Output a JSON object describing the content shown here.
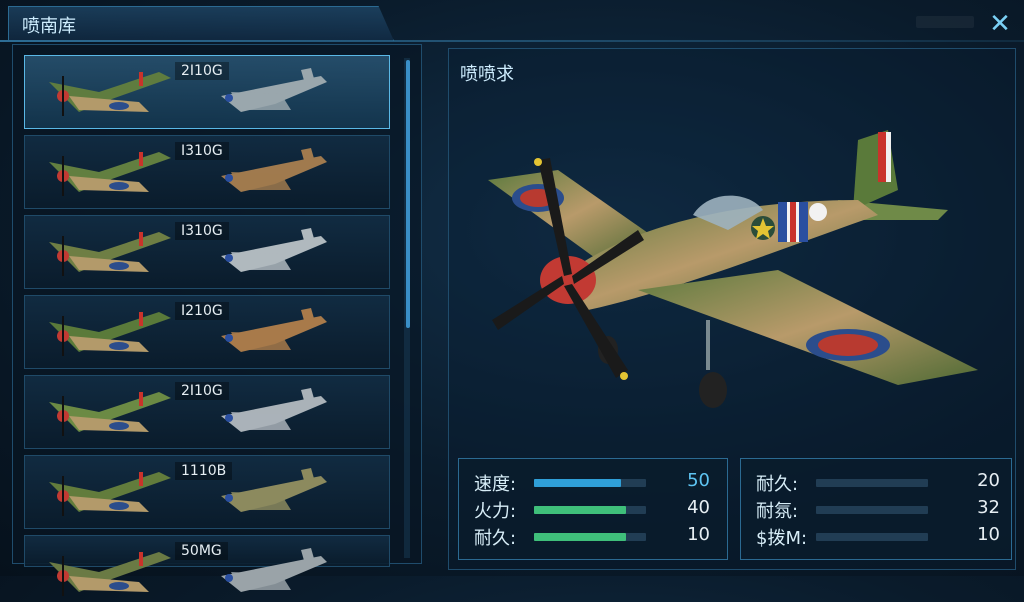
{
  "header": {
    "title": "喷南库"
  },
  "close": {
    "label": "✕"
  },
  "list": {
    "rows": [
      {
        "price": "2I10G",
        "selected": true
      },
      {
        "price": "I310G"
      },
      {
        "price": "I310G"
      },
      {
        "price": "I210G"
      },
      {
        "price": "2I10G"
      },
      {
        "price": "1110B"
      },
      {
        "price": "50MG"
      }
    ]
  },
  "detail": {
    "title": "喷喷求",
    "stats_left": [
      {
        "label": "速度:",
        "value": "50",
        "fraction": 0.78,
        "color": "#2f9fd8",
        "value_color": "#5ec4f2"
      },
      {
        "label": "火力:",
        "value": "40",
        "fraction": 0.82,
        "color": "#3fbf7a",
        "value_color": "#e6eef3"
      },
      {
        "label": "耐久:",
        "value": "10",
        "fraction": 0.82,
        "color": "#3fbf7a",
        "value_color": "#e6eef3"
      }
    ],
    "stats_right": [
      {
        "label": "耐久:",
        "value": "20",
        "fraction": 0.0,
        "color": "#3fbf7a",
        "value_color": "#e6eef3"
      },
      {
        "label": "耐氛:",
        "value": "32",
        "fraction": 0.0,
        "color": "#3fbf7a",
        "value_color": "#e6eef3"
      },
      {
        "label": "$拨M:",
        "value": "10",
        "fraction": 0.0,
        "color": "#3fbf7a",
        "value_color": "#e6eef3"
      }
    ]
  }
}
